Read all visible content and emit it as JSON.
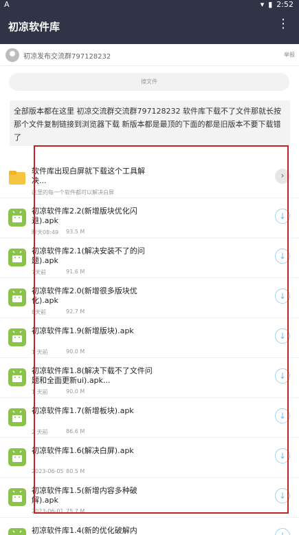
{
  "status_bar": {
    "left_text": "A",
    "time": "2:52"
  },
  "app": {
    "title": "初凉软件库",
    "menu_icon": "more-vert-icon"
  },
  "header": {
    "group": "初凉发布交流群797128232",
    "report": "举报"
  },
  "search": {
    "placeholder": "搜文件"
  },
  "notice": {
    "text": "全部版本都在这里 初凉交流群交流群797128232 软件库下载不了文件那就长按那个文件复制链接到浏览器下载 新版本都是最顶的下面的都是旧版本不要下载错了"
  },
  "files": [
    {
      "type": "folder",
      "name": "软件库出现白屏就下载这个工具解决...",
      "meta": "这里的每一个软件都可以解决白屏",
      "size": ""
    },
    {
      "type": "apk",
      "name": "初凉软件库2.2(新增版块优化闪退).apk",
      "meta": "昨天08:49",
      "size": "93.5 M"
    },
    {
      "type": "apk",
      "name": "初凉软件库2.1(解决安装不了的问题).apk",
      "meta": "7天前",
      "size": "91.6 M"
    },
    {
      "type": "apk",
      "name": "初凉软件库2.0(新增很多版块优化).apk",
      "meta": "8天前",
      "size": "92.7 M"
    },
    {
      "type": "apk",
      "name": "初凉软件库1.9(新增版块).apk",
      "meta": "1 天前",
      "size": "90.0 M"
    },
    {
      "type": "apk",
      "name": "初凉软件库1.8(解决下载不了文件问题和全面更新ui).apk...",
      "meta": "1 天前",
      "size": "90.0 M"
    },
    {
      "type": "apk",
      "name": "初凉软件库1.7(新增板块).apk",
      "meta": "2 天前",
      "size": "86.6 M"
    },
    {
      "type": "apk",
      "name": "初凉软件库1.6(解决白屏).apk",
      "meta": "2023-06-05",
      "size": "80.5 M"
    },
    {
      "type": "apk",
      "name": "初凉软件库1.5(新增内容多种破解).apk",
      "meta": "2023-06-01",
      "size": "75.7 M"
    },
    {
      "type": "apk",
      "name": "初凉软件库1.4(新的优化破解内",
      "meta": "",
      "size": ""
    }
  ],
  "colors": {
    "topbar": "#2f3547",
    "apk_icon": "#8bc34a",
    "folder_icon": "#f5c542",
    "action": "#6cbdee",
    "highlight_box": "#c72020"
  }
}
